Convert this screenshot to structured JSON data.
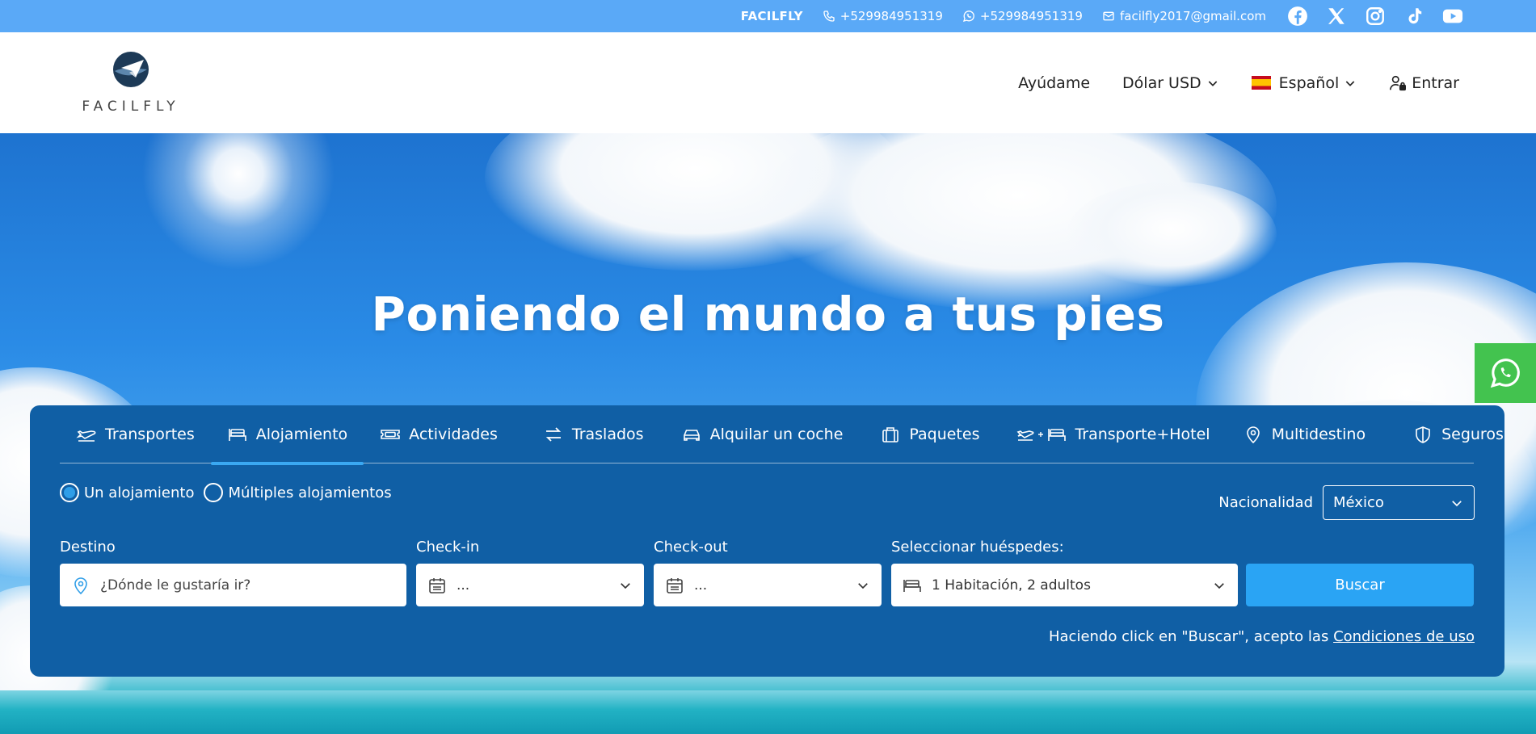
{
  "topbar": {
    "brand": "FACILFLY",
    "phone": "+529984951319",
    "whatsapp": "+529984951319",
    "email": "facilfly2017@gmail.com",
    "social": [
      "facebook-icon",
      "x-icon",
      "instagram-icon",
      "tiktok-icon",
      "youtube-icon"
    ]
  },
  "logo": {
    "text": "FACILFLY"
  },
  "nav": {
    "help": "Ayúdame",
    "currency": "Dólar USD",
    "language": "Español",
    "login": "Entrar"
  },
  "hero": {
    "title": "Poniendo el mundo a tus pies"
  },
  "tabs": [
    {
      "label": "Transportes",
      "icon": "plane-icon"
    },
    {
      "label": "Alojamiento",
      "icon": "bed-icon",
      "active": true
    },
    {
      "label": "Actividades",
      "icon": "ticket-icon"
    },
    {
      "label": "Traslados",
      "icon": "transfer-icon"
    },
    {
      "label": "Alquilar un coche",
      "icon": "car-icon"
    },
    {
      "label": "Paquetes",
      "icon": "luggage-icon"
    },
    {
      "label": "Transporte+Hotel",
      "icon": "plane-bed-icon"
    },
    {
      "label": "Multidestino",
      "icon": "map-pin-icon"
    },
    {
      "label": "Seguros",
      "icon": "shield-icon"
    }
  ],
  "search": {
    "radio_one": "Un alojamiento",
    "radio_multi": "Múltiples alojamientos",
    "nationality_label": "Nacionalidad",
    "nationality_value": "México",
    "destino_label": "Destino",
    "destino_placeholder": "¿Dónde le gustaría ir?",
    "checkin_label": "Check-in",
    "checkin_value": "...",
    "checkout_label": "Check-out",
    "checkout_value": "...",
    "guests_label": "Seleccionar huéspedes:",
    "guests_value": "1 Habitación, 2 adultos",
    "button": "Buscar",
    "terms_text": "Haciendo click en \"Buscar\", acepto las",
    "terms_link": "Condiciones de uso"
  },
  "colors": {
    "topbar": "#5aa9f7",
    "panel": "#105fa5",
    "button": "#2aa4f4",
    "whatsapp": "#43c34f"
  }
}
